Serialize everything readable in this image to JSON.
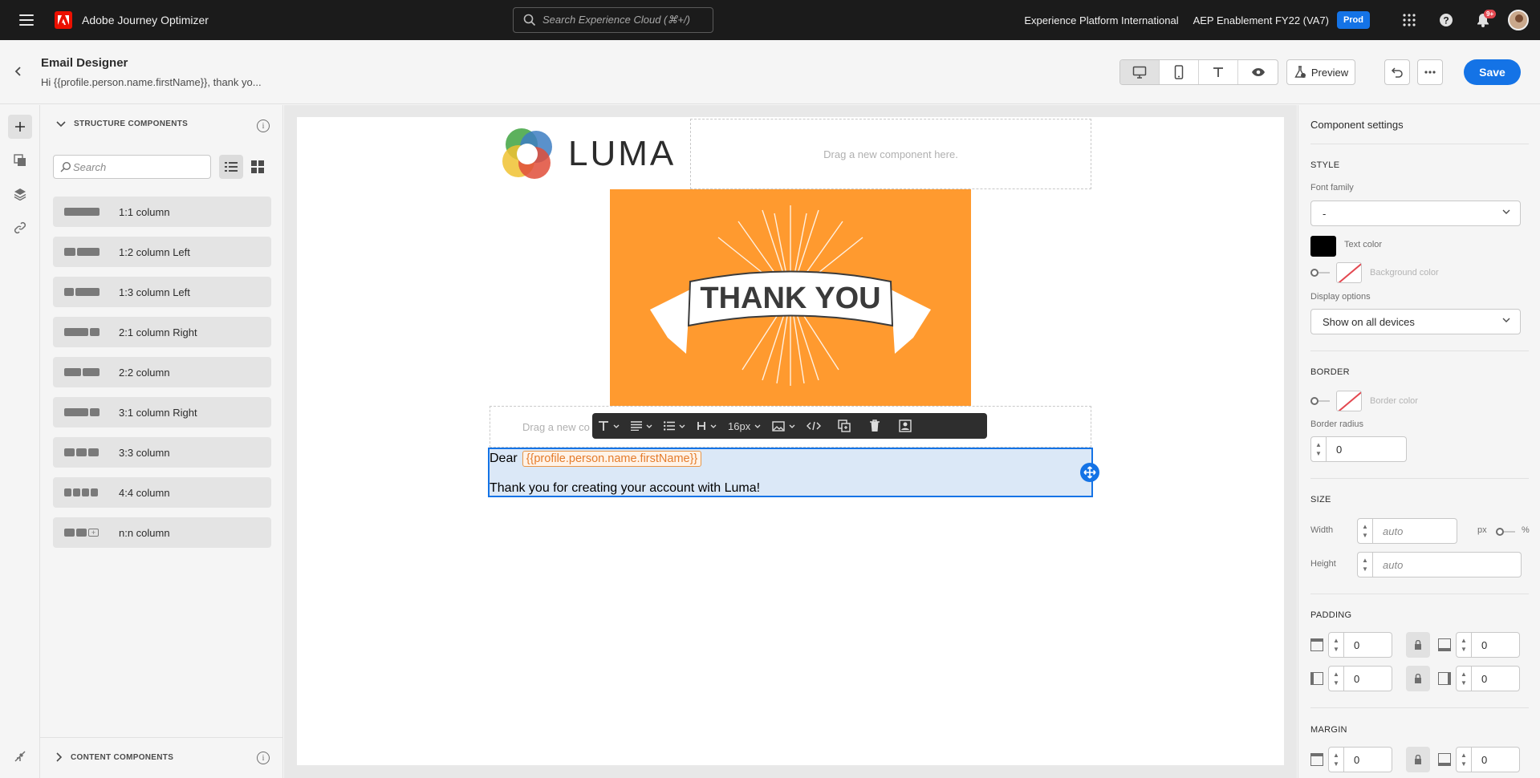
{
  "topbar": {
    "app_name": "Adobe Journey Optimizer",
    "search_placeholder": "Search Experience Cloud (⌘+/)",
    "org": "Experience Platform International",
    "sandbox": "AEP Enablement FY22 (VA7)",
    "env_badge": "Prod",
    "notification_count": "9+"
  },
  "header": {
    "title": "Email Designer",
    "subtitle": "Hi {{profile.person.name.firstName}}, thank yo...",
    "preview_label": "Preview",
    "save_label": "Save"
  },
  "left_panel": {
    "structure_title": "STRUCTURE COMPONENTS",
    "search_placeholder": "Search",
    "items": [
      {
        "label": "1:1 column"
      },
      {
        "label": "1:2 column Left"
      },
      {
        "label": "1:3 column Left"
      },
      {
        "label": "2:1 column Right"
      },
      {
        "label": "2:2 column"
      },
      {
        "label": "3:1 column Right"
      },
      {
        "label": "3:3 column"
      },
      {
        "label": "4:4 column"
      },
      {
        "label": "n:n column"
      }
    ],
    "content_title": "CONTENT COMPONENTS"
  },
  "canvas": {
    "drop_hint": "Drag a new component here.",
    "drop_hint_partial": "Drag a new co",
    "logo_text": "LUMA",
    "hero_text": "THANK YOU",
    "text_line1": "Dear",
    "personalization_token": "{{profile.person.name.firstName}}",
    "text_line2": "Thank you for creating your account with Luma!",
    "toolbar_font_size": "16px",
    "hero_color": "#ff9a2f"
  },
  "right_panel": {
    "title": "Component settings",
    "style": {
      "section": "STYLE",
      "font_family_label": "Font family",
      "font_family_value": "-",
      "text_color_label": "Text color",
      "text_color": "#000000",
      "bg_color_label": "Background color",
      "display_options_label": "Display options",
      "display_options_value": "Show on all devices"
    },
    "border": {
      "section": "BORDER",
      "border_color_label": "Border color",
      "border_radius_label": "Border radius",
      "border_radius_value": "0"
    },
    "size": {
      "section": "SIZE",
      "width_label": "Width",
      "width_placeholder": "auto",
      "unit_px": "px",
      "unit_pct": "%",
      "height_label": "Height",
      "height_placeholder": "auto"
    },
    "padding": {
      "section": "PADDING",
      "top": "0",
      "bottom": "0",
      "left": "0",
      "right": "0"
    },
    "margin": {
      "section": "MARGIN",
      "top": "0",
      "bottom": "0"
    }
  }
}
